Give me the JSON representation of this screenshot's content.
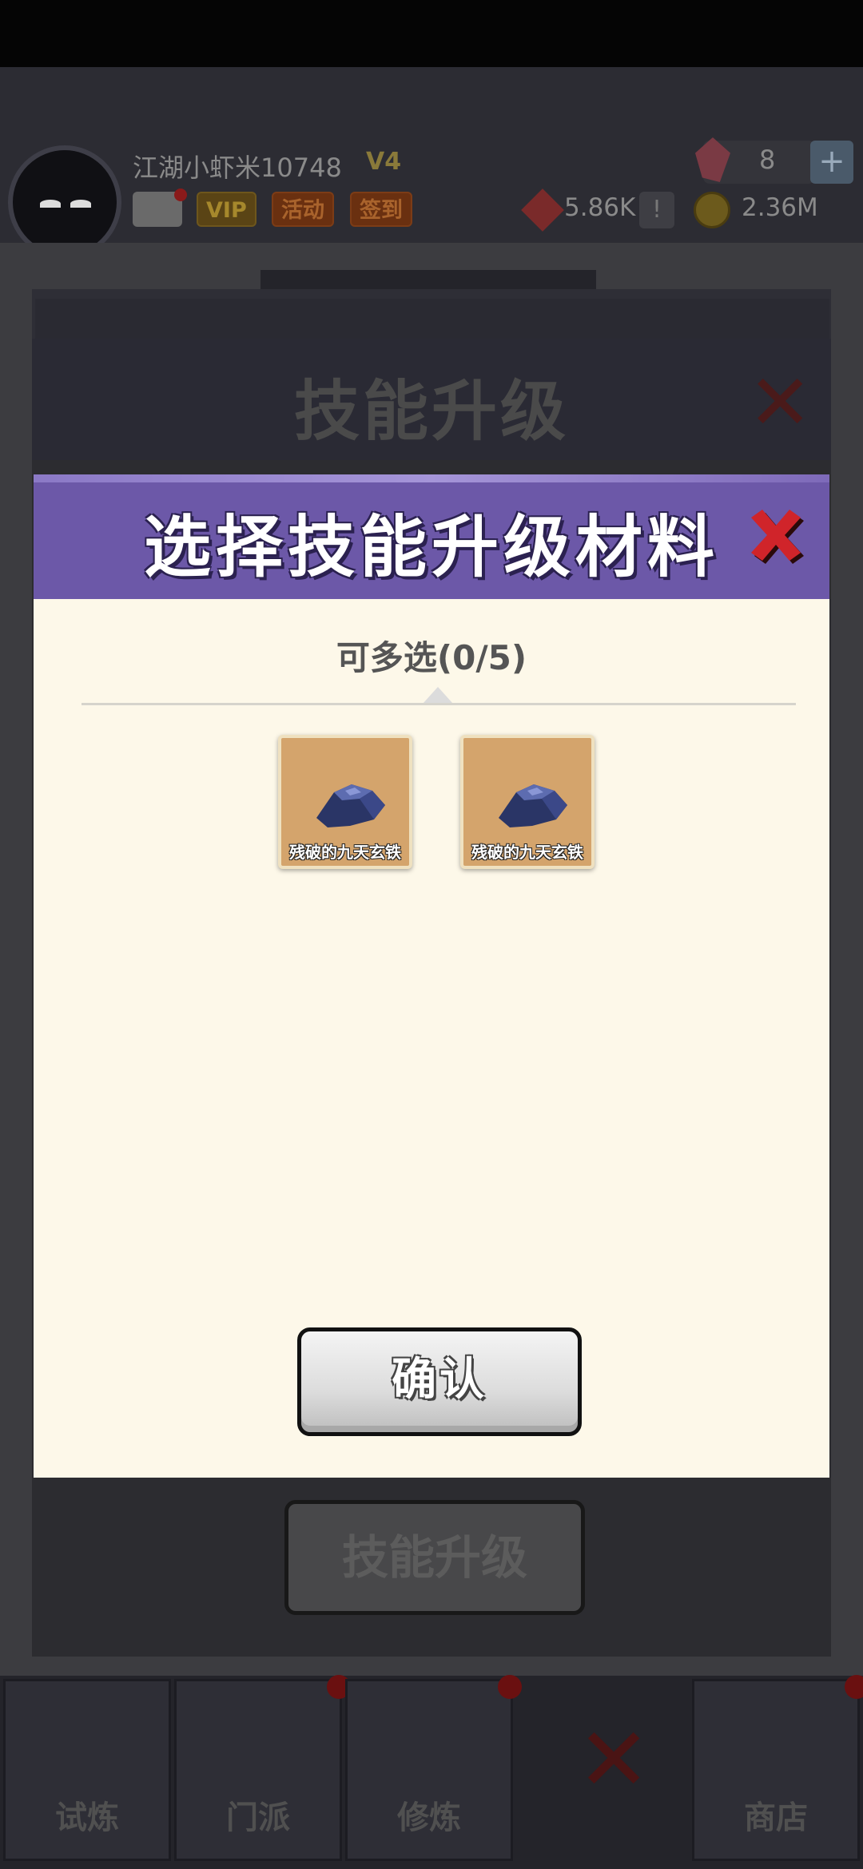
{
  "header": {
    "username": "江湖小虾米10748",
    "vip_level": "V4",
    "buttons": {
      "vip": "VIP",
      "activity": "活动",
      "signin": "签到"
    },
    "gems": "8",
    "gem_add": "+",
    "token_value": "5.86K",
    "token_add": "!",
    "coins": "2.36M"
  },
  "background_panel": {
    "title": "技能升级",
    "upgrade_button": "技能升级"
  },
  "modal": {
    "title": "选择技能升级材料",
    "multi_select_label": "可多选(0/5)",
    "materials": [
      {
        "name": "残破的九天玄铁"
      },
      {
        "name": "残破的九天玄铁"
      }
    ],
    "confirm_label": "确认"
  },
  "bottom_nav": {
    "items": [
      {
        "label": "试炼"
      },
      {
        "label": "门派"
      },
      {
        "label": "修炼"
      },
      {
        "label": "商店"
      }
    ]
  },
  "colors": {
    "modal_header": "#6c58a8",
    "modal_body": "#fdf8e9",
    "close_red": "#d0242a"
  }
}
